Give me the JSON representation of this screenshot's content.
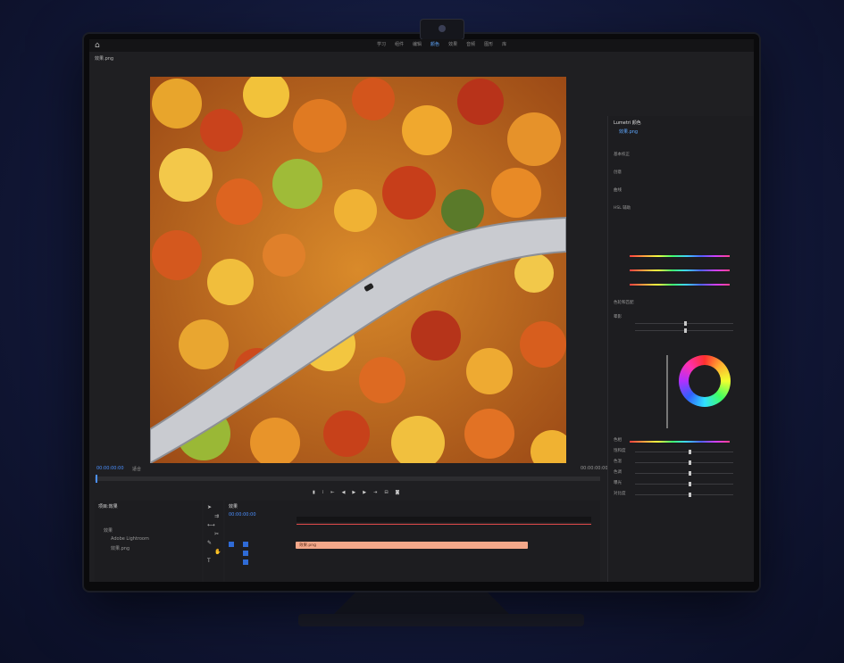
{
  "app": {
    "file_tab": "效果.png",
    "tabs": [
      {
        "label": "学习",
        "active": false
      },
      {
        "label": "组件",
        "active": false
      },
      {
        "label": "编辑",
        "active": false
      },
      {
        "label": "颜色",
        "active": true
      },
      {
        "label": "效果",
        "active": false
      },
      {
        "label": "音频",
        "active": false
      },
      {
        "label": "图形",
        "active": false
      },
      {
        "label": "库",
        "active": false
      }
    ]
  },
  "viewer": {
    "timecode_left": "00:00:00:00",
    "fit_label": "适合",
    "timecode_right": "00:00:00:00"
  },
  "right_panel": {
    "title": "Lumetri 颜色",
    "source_label": "效果.png",
    "section_basic": "基本校正",
    "section_creative": "创意",
    "section_curves": "曲线",
    "section_hsl": "HSL 辅助",
    "section_color_wheels": "色轮和匹配",
    "section_vignette": "晕影",
    "labels": [
      "色相",
      "饱和度",
      "色温",
      "色调",
      "曝光",
      "对比度"
    ]
  },
  "bottom": {
    "project_title": "项目:效果",
    "timeline_title": "效果",
    "timeline_timecode": "00:00:00:00",
    "clip_name": "效果.png",
    "project_items": [
      "效果",
      "Adobe Lightroom",
      "效果.png"
    ]
  },
  "colors": {
    "accent": "#4b90ff",
    "clip": "#f3a88a",
    "road": "#c9cbd0"
  }
}
